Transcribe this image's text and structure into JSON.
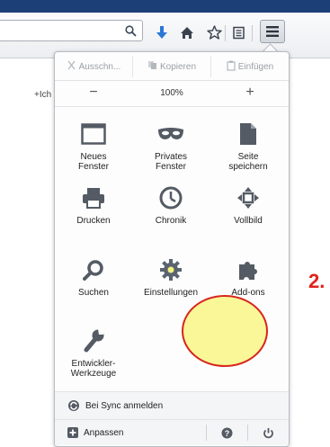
{
  "browser": {
    "colors": {
      "titlebar": "#1d3f78",
      "download_arrow": "#2a77d6",
      "highlight": "#f7f57a",
      "highlight_ring": "#d7251c",
      "step_label": "#e0231c"
    },
    "nav_icons": [
      "search-icon",
      "download-icon",
      "home-icon",
      "bookmark-star-icon",
      "bookmarks-list-icon",
      "hamburger-menu-icon"
    ]
  },
  "page": {
    "side_text": "+Ich"
  },
  "menu": {
    "edit": {
      "cut": "Ausschn...",
      "copy": "Kopieren",
      "paste": "Einfügen"
    },
    "zoom": {
      "minus": "−",
      "value": "100%",
      "plus": "+"
    },
    "items": {
      "new_window": "Neues\nFenster",
      "private_window": "Privates\nFenster",
      "save_page": "Seite\nspeichern",
      "print": "Drucken",
      "history": "Chronik",
      "fullscreen": "Vollbild",
      "find": "Suchen",
      "settings": "Einstellungen",
      "addons": "Add-ons",
      "developer": "Entwickler-\nWerkzeuge"
    },
    "sync": "Bei Sync anmelden",
    "customize": "Anpassen"
  },
  "annotation": {
    "step": "2."
  }
}
